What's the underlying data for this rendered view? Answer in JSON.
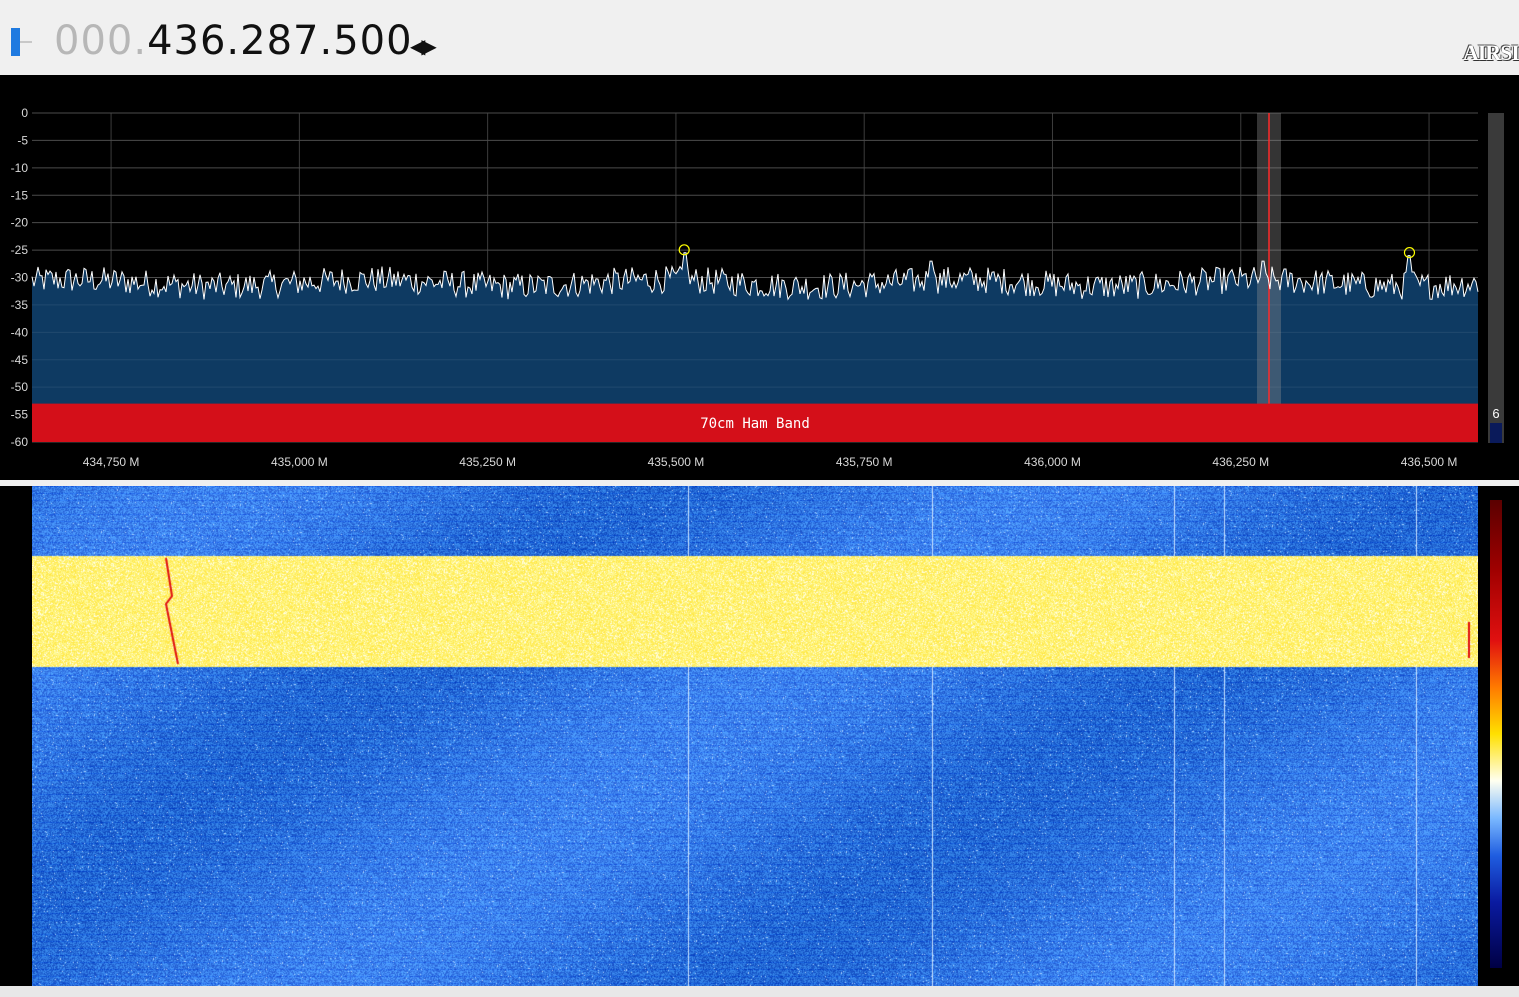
{
  "header": {
    "frequency_lead": "000.",
    "frequency_main": "436.287.500",
    "frequency_arrows": "◀▶",
    "logo_text": "AIRSI"
  },
  "spectrum": {
    "y_ticks": [
      "0",
      "-5",
      "-10",
      "-15",
      "-20",
      "-25",
      "-30",
      "-35",
      "-40",
      "-45",
      "-50",
      "-55",
      "-60"
    ],
    "x_ticks": [
      "434,750 M",
      "435,000 M",
      "435,250 M",
      "435,500 M",
      "435,750 M",
      "436,000 M",
      "436,250 M",
      "436,500 M"
    ],
    "band_label": "70cm Ham Band",
    "level_value": "6",
    "tuned_frequency_mhz": 436.2875,
    "colors": {
      "fill": "#0e3a62",
      "band": "#d40f19",
      "trace": "#ffffff",
      "peak_marker": "#ffff00",
      "tuner_line": "#ff2a2a"
    }
  },
  "waterfall": {
    "colors": {
      "noise": "#1f5de0",
      "burst": "#fff35a"
    }
  },
  "chart_data": {
    "type": "line",
    "xlabel": "",
    "ylabel": "",
    "x_range_mhz": [
      434.645,
      436.565
    ],
    "ylim": [
      -60,
      0
    ],
    "noise_floor_db": -31,
    "peaks": [
      {
        "freq_mhz": 435.511,
        "db": -25.5,
        "marked": true
      },
      {
        "freq_mhz": 436.474,
        "db": -26,
        "marked": true
      },
      {
        "freq_mhz": 435.84,
        "db": -27,
        "marked": false
      },
      {
        "freq_mhz": 436.28,
        "db": -27,
        "marked": false
      }
    ],
    "bands": [
      {
        "label": "70cm Ham Band",
        "from_db": -53,
        "to_db": -60
      }
    ]
  }
}
